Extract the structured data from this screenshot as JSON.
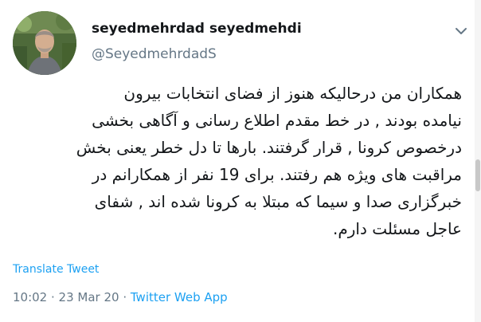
{
  "tweet": {
    "author": {
      "display_name": "seyedmehrdad seyedmehdi",
      "handle": "@SeyedmehrdadS"
    },
    "text_lines": [
      "همکاران من درحالیکه هنوز از فضای انتخابات بیرون",
      "نیامده بودند , در خط مقدم اطلاع رسانی و آگاهی بخشی",
      "درخصوص کرونا , قرار گرفتند. بارها تا دل خطر یعنی بخش",
      "مراقبت های ویژه هم رفتند. برای 19 نفر از همکارانم در",
      "خبرگزاری صدا و سیما که مبتلا به کرونا شده اند , شفای",
      "عاجل مسئلت دارم."
    ],
    "translate_label": "Translate Tweet",
    "time": "10:02",
    "date": "23 Mar 20",
    "separator": " · ",
    "source": "Twitter Web App"
  },
  "icons": {
    "menu": "chevron-down-icon",
    "avatar": "profile-photo"
  },
  "colors": {
    "link": "#1da1f2",
    "secondary_text": "#657786",
    "primary_text": "#14171a"
  }
}
